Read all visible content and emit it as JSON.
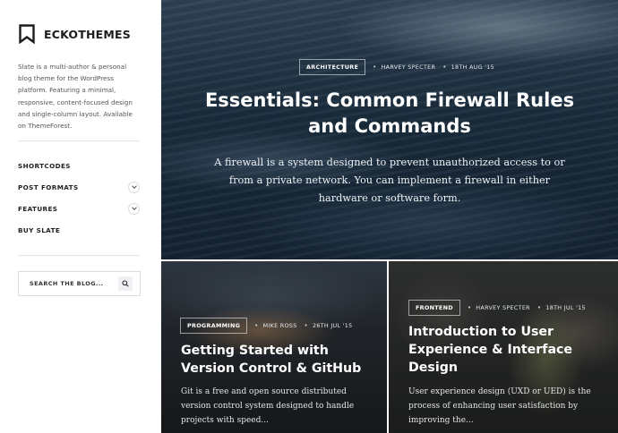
{
  "sidebar": {
    "brand": "ECKOTHEMES",
    "about": "Slate is a multi-author & personal blog theme for the WordPress platform. Featuring a minimal, responsive, content-focused design and single-column layout. Available on ThemeForest.",
    "nav": [
      {
        "label": "SHORTCODES",
        "has_dropdown": false
      },
      {
        "label": "POST FORMATS",
        "has_dropdown": true,
        "icon": "chevron-down-icon"
      },
      {
        "label": "FEATURES",
        "has_dropdown": true,
        "icon": "chevron-down-icon"
      },
      {
        "label": "BUY SLATE",
        "has_dropdown": false
      }
    ],
    "search": {
      "placeholder": "SEARCH THE BLOG...",
      "icon": "search-icon"
    }
  },
  "hero": {
    "category": "ARCHITECTURE",
    "author": "HARVEY SPECTER",
    "date": "18TH AUG '15",
    "title": "Essentials: Common Firewall Rules and Commands",
    "excerpt": "A firewall is a system designed to prevent unauthorized access to or from a private network. You can implement a firewall in either hardware or software form."
  },
  "posts": [
    {
      "category": "PROGRAMMING",
      "author": "MIKE ROSS",
      "date": "26TH JUL '15",
      "title": "Getting Started with Version Control & GitHub",
      "excerpt": "Git is a free and open source distributed version control system designed to handle projects with speed..."
    },
    {
      "category": "FRONTEND",
      "author": "HARVEY SPECTER",
      "date": "18TH JUL '15",
      "title": "Introduction to User Experience & Interface Design",
      "excerpt": "User experience design (UXD or UED) is the process of enhancing user satisfaction by improving the..."
    }
  ],
  "colors": {
    "accent": "#ffffff",
    "text_dark": "#1c1c1c",
    "border": "#dcdcdc"
  }
}
